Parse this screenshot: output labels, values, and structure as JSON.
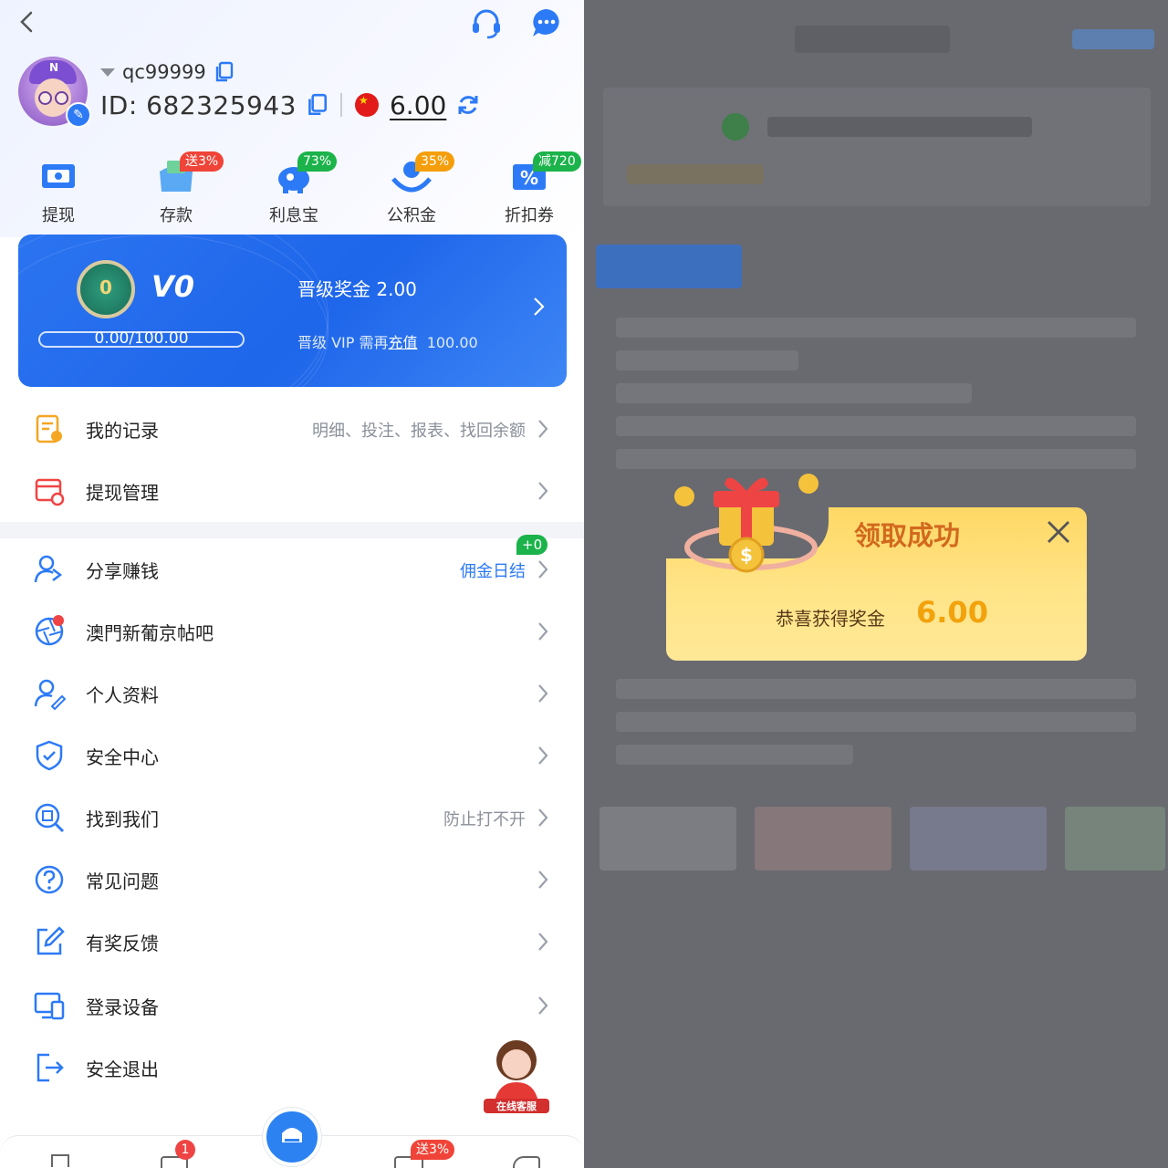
{
  "profile": {
    "username": "qc99999",
    "id_text": "ID: 682325943",
    "balance": "6.00",
    "avatar_letter": "N"
  },
  "quick_actions": [
    {
      "label": "提现",
      "badge": "",
      "icon": "withdraw-icon"
    },
    {
      "label": "存款",
      "badge": "送3%",
      "badge_color": "#f04438",
      "icon": "deposit-wallet-icon"
    },
    {
      "label": "利息宝",
      "badge": "73%",
      "badge_color": "#1bb34a",
      "icon": "piggy-bank-icon"
    },
    {
      "label": "公积金",
      "badge": "35%",
      "badge_color": "#f59e0b",
      "icon": "fund-hands-icon"
    },
    {
      "label": "折扣券",
      "badge": "减720",
      "badge_color": "#1bb34a",
      "icon": "coupon-icon"
    }
  ],
  "vip": {
    "level": "V0",
    "medal_digit": "0",
    "progress_text": "0.00/100.00",
    "progress": 0,
    "bonus_text": "晋级奖金  2.00",
    "req_prefix": "晋级 VIP 需再",
    "req_link": "充值",
    "req_amount": "100.00"
  },
  "menu": {
    "records": {
      "label": "我的记录",
      "right": "明细、投注、报表、找回余额"
    },
    "withdraw_manage": {
      "label": "提现管理",
      "right": ""
    },
    "share": {
      "label": "分享赚钱",
      "right": "佣金日结",
      "badge": "+0"
    },
    "forum": {
      "label": "澳門新葡京帖吧",
      "right": ""
    },
    "profile": {
      "label": "个人资料",
      "right": ""
    },
    "security": {
      "label": "安全中心",
      "right": ""
    },
    "find_us": {
      "label": "找到我们",
      "right": "防止打不开"
    },
    "faq": {
      "label": "常见问题",
      "right": ""
    },
    "feedback": {
      "label": "有奖反馈",
      "right": ""
    },
    "devices": {
      "label": "登录设备",
      "right": ""
    },
    "logout": {
      "label": "安全退出",
      "right": ""
    }
  },
  "customer_service": {
    "label": "在线客服"
  },
  "bottom_nav": {
    "badge_count": "1",
    "badge_promo": "送3%"
  },
  "popup": {
    "title": "领取成功",
    "message": "恭喜获得奖金",
    "amount": "6.00"
  },
  "colors": {
    "primary": "#2d7af6",
    "vip_blue": "#1e66ea",
    "popup_yellow": "#ffd865",
    "popup_title": "#d2691e",
    "amount_orange": "#f2a20b"
  }
}
